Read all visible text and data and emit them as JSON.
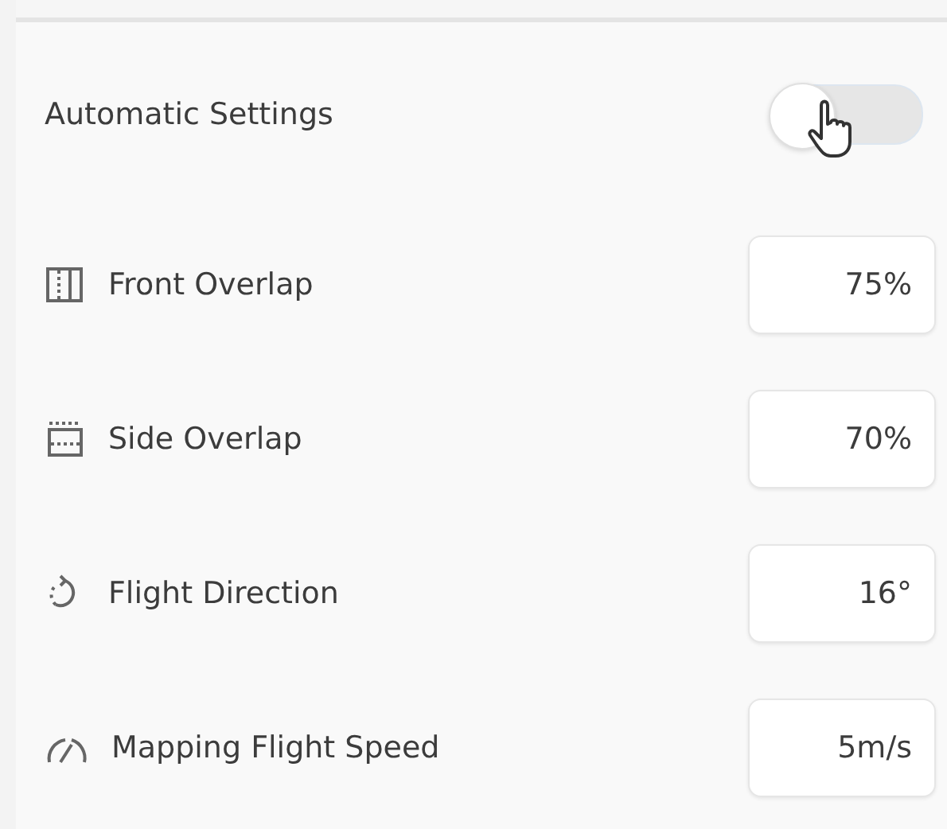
{
  "automatic_settings": {
    "label": "Automatic Settings",
    "on": false
  },
  "parameters": [
    {
      "kind": "front",
      "label": "Front Overlap",
      "value": "75%"
    },
    {
      "kind": "side",
      "label": "Side Overlap",
      "value": "70%"
    },
    {
      "kind": "direction",
      "label": "Flight Direction",
      "value": "16°"
    },
    {
      "kind": "speed",
      "label": "Mapping Flight Speed",
      "value": "5m/s"
    }
  ]
}
